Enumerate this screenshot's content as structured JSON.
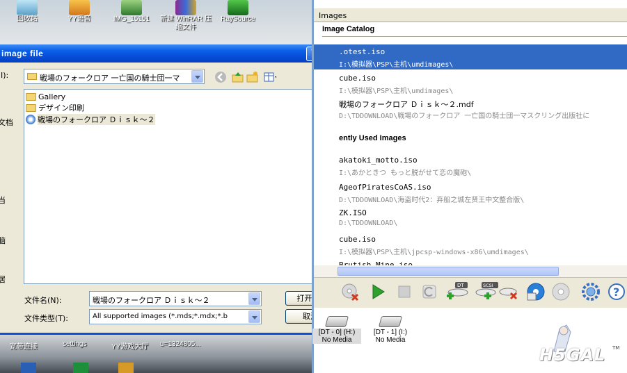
{
  "desktop": {
    "top_icons": [
      {
        "label": "回收站"
      },
      {
        "label": "YY语音"
      },
      {
        "label": "IMG_15151"
      },
      {
        "label": "新建 WinRAR 压缩文件"
      },
      {
        "label": "RaySource"
      }
    ],
    "bottom_icons": [
      {
        "label": "宽带连接"
      },
      {
        "label": "settings"
      },
      {
        "label": "YY游戏大厅"
      },
      {
        "label": "u=1324805..."
      }
    ],
    "colors": {
      "taskbar_blue": "#0b50d6"
    }
  },
  "dialog": {
    "title": "image file",
    "help_label": "?",
    "close_label": "×",
    "look_in_label": "I):",
    "look_in_value": "戦場のフォークロア 一亡国の騎士団一マ",
    "places_labels": [
      "文档",
      "当",
      "脑",
      "居"
    ],
    "items": [
      {
        "name": "Gallery",
        "icon": "folder-icon"
      },
      {
        "name": "デザイン印刷",
        "icon": "folder-icon"
      },
      {
        "name": "戦場のフォークロア Ｄｉｓｋ～２",
        "icon": "disc-image-icon"
      }
    ],
    "filename_label": "文件名(N):",
    "filename_value": "戦場のフォークロア Ｄｉｓｋ～２",
    "filetype_label": "文件类型(T):",
    "filetype_value": "All supported images (*.mds;*.mdx;*.b",
    "open_button": "打开(O)",
    "cancel_button": "取消"
  },
  "panel": {
    "tab_label": "Images",
    "catalog_header": "Image Catalog",
    "catalog": [
      {
        "name": ".otest.iso",
        "path": "I:\\模拟器\\PSP\\主机\\umdimages\\"
      },
      {
        "name": "cube.iso",
        "path": "I:\\模拟器\\PSP\\主机\\umdimages\\"
      },
      {
        "name": "戦場のフォークロア Ｄｉｓｋ～２.mdf",
        "path": "D:\\TDDOWNLOAD\\戦場のフォークロア 一亡国の騎士団一マスクリング出版社に"
      }
    ],
    "recent_header": "ently Used Images",
    "recent": [
      {
        "name": "akatoki_motto.iso",
        "path": "I:\\あかときつ もっと脱がせて恋の魔砲\\"
      },
      {
        "name": "AgeofPiratesCoAS.iso",
        "path": "D:\\TDDOWNLOAD\\海盗时代2：弃船之城左贤王中文整合版\\"
      },
      {
        "name": "ZK.ISO",
        "path": "D:\\TDDOWNLOAD\\"
      },
      {
        "name": "cube.iso",
        "path": "I:\\模拟器\\PSP\\主机\\jpcsp-windows-x86\\umdimages\\"
      },
      {
        "name": "Brutish_Mine.iso",
        "path": ""
      }
    ],
    "toolbar": [
      {
        "name": "remove-image-icon"
      },
      {
        "name": "play-icon"
      },
      {
        "name": "stop-icon"
      },
      {
        "name": "refresh-icon"
      },
      {
        "name": "add-dt-drive-icon",
        "label": "DT"
      },
      {
        "name": "add-scsi-drive-icon",
        "label": "SCSI"
      },
      {
        "name": "remove-drive-icon"
      },
      {
        "name": "write-image-icon"
      },
      {
        "name": "disc-icon"
      },
      {
        "name": "settings-icon"
      },
      {
        "name": "help-icon",
        "label": "?"
      }
    ],
    "devices": [
      {
        "label": "[DT - 0] (H:)",
        "status": "No Media"
      },
      {
        "label": "[DT - 1] (I:)",
        "status": "No Media"
      }
    ],
    "logo": "H5GAL",
    "tm": "TM",
    "colors": {
      "selection": "#316ac5",
      "play_green": "#2ea02e"
    }
  }
}
